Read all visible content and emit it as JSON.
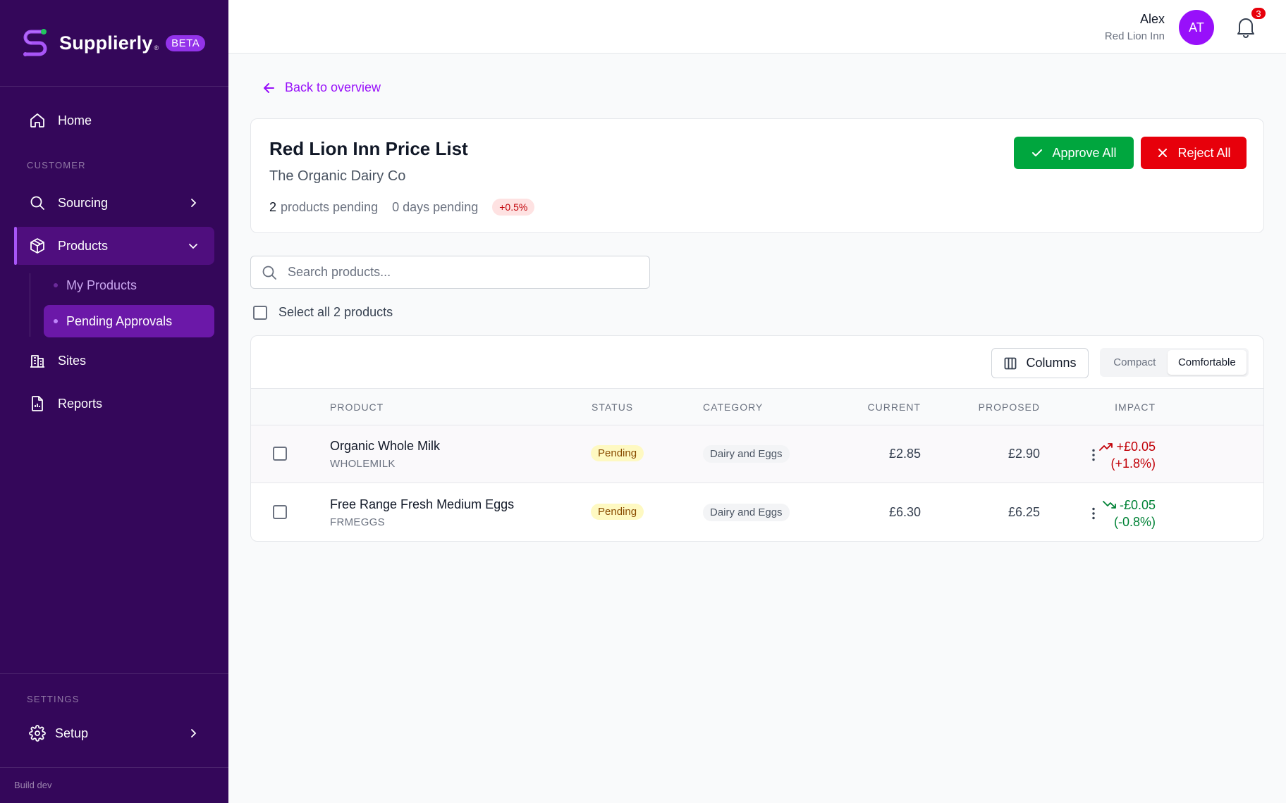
{
  "brand": {
    "name": "Supplierly",
    "reg": "®",
    "badge": "BETA"
  },
  "sidebar": {
    "home": "Home",
    "customer_label": "CUSTOMER",
    "sourcing": "Sourcing",
    "products": "Products",
    "my_products": "My Products",
    "pending_approvals": "Pending Approvals",
    "sites": "Sites",
    "reports": "Reports",
    "settings_label": "SETTINGS",
    "setup": "Setup",
    "build": "Build dev"
  },
  "topbar": {
    "user_name": "Alex",
    "user_org": "Red Lion Inn",
    "avatar_initials": "AT",
    "notification_count": "3"
  },
  "page": {
    "back_label": "Back to overview",
    "title": "Red Lion Inn Price List",
    "supplier": "The Organic Dairy Co",
    "pending_count": "2",
    "pending_label": "products pending",
    "days_pending": "0 days pending",
    "overall_impact": "+0.5%",
    "approve_all": "Approve All",
    "reject_all": "Reject All",
    "search_placeholder": "Search products...",
    "select_all": "Select all 2 products"
  },
  "table": {
    "columns_button": "Columns",
    "density": {
      "compact": "Compact",
      "comfortable": "Comfortable",
      "selected": "Comfortable"
    },
    "headers": {
      "product": "PRODUCT",
      "status": "STATUS",
      "category": "CATEGORY",
      "current": "CURRENT",
      "proposed": "PROPOSED",
      "impact": "IMPACT"
    },
    "rows": [
      {
        "name": "Organic Whole Milk",
        "sku": "WHOLEMILK",
        "status": "Pending",
        "category": "Dairy and Eggs",
        "current": "£2.85",
        "proposed": "£2.90",
        "impact_value": "+£0.05",
        "impact_pct": "(+1.8%)",
        "direction": "up"
      },
      {
        "name": "Free Range Fresh Medium Eggs",
        "sku": "FRMEGGS",
        "status": "Pending",
        "category": "Dairy and Eggs",
        "current": "£6.30",
        "proposed": "£6.25",
        "impact_value": "-£0.05",
        "impact_pct": "(-0.8%)",
        "direction": "down"
      }
    ]
  },
  "colors": {
    "sidebar_bg": "#34075a",
    "accent": "#9810fa",
    "approve": "#00a63e",
    "reject": "#e7000b",
    "increase": "#c10007",
    "decrease": "#008236"
  }
}
